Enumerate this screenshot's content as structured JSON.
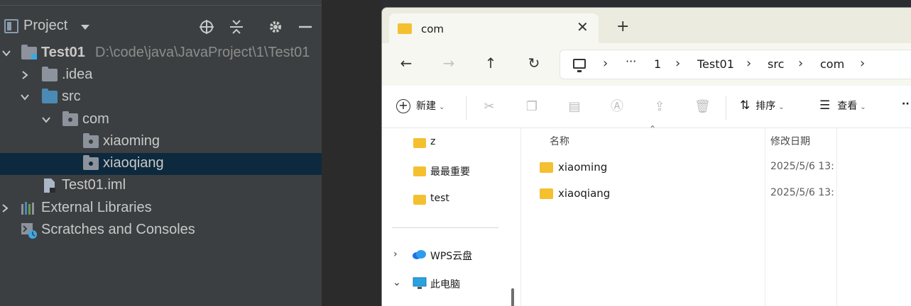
{
  "ide": {
    "panel_title": "Project",
    "tree": [
      {
        "label": "Test01",
        "path": "D:\\code\\java\\JavaProject\\1\\Test01"
      },
      {
        "label": ".idea"
      },
      {
        "label": "src"
      },
      {
        "label": "com"
      },
      {
        "label": "xiaoming"
      },
      {
        "label": "xiaoqiang"
      },
      {
        "label": "Test01.iml"
      },
      {
        "label": "External Libraries"
      },
      {
        "label": "Scratches and Consoles"
      }
    ]
  },
  "explorer": {
    "tab_title": "com",
    "address": [
      "1",
      "Test01",
      "src",
      "com"
    ],
    "toolbar": {
      "new_label": "新建",
      "sort_label": "排序",
      "view_label": "查看"
    },
    "nav_items": [
      "z",
      "最最重要",
      "test",
      "WPS云盘",
      "此电脑"
    ],
    "columns": {
      "name": "名称",
      "date": "修改日期"
    },
    "files": [
      {
        "name": "xiaoming",
        "date": "2025/5/6 13:"
      },
      {
        "name": "xiaoqiang",
        "date": "2025/5/6 13:"
      }
    ]
  },
  "colors": {
    "ide_bg": "#3c3f41",
    "ide_selection": "#0d293e",
    "folder_yellow": "#f4c030"
  }
}
